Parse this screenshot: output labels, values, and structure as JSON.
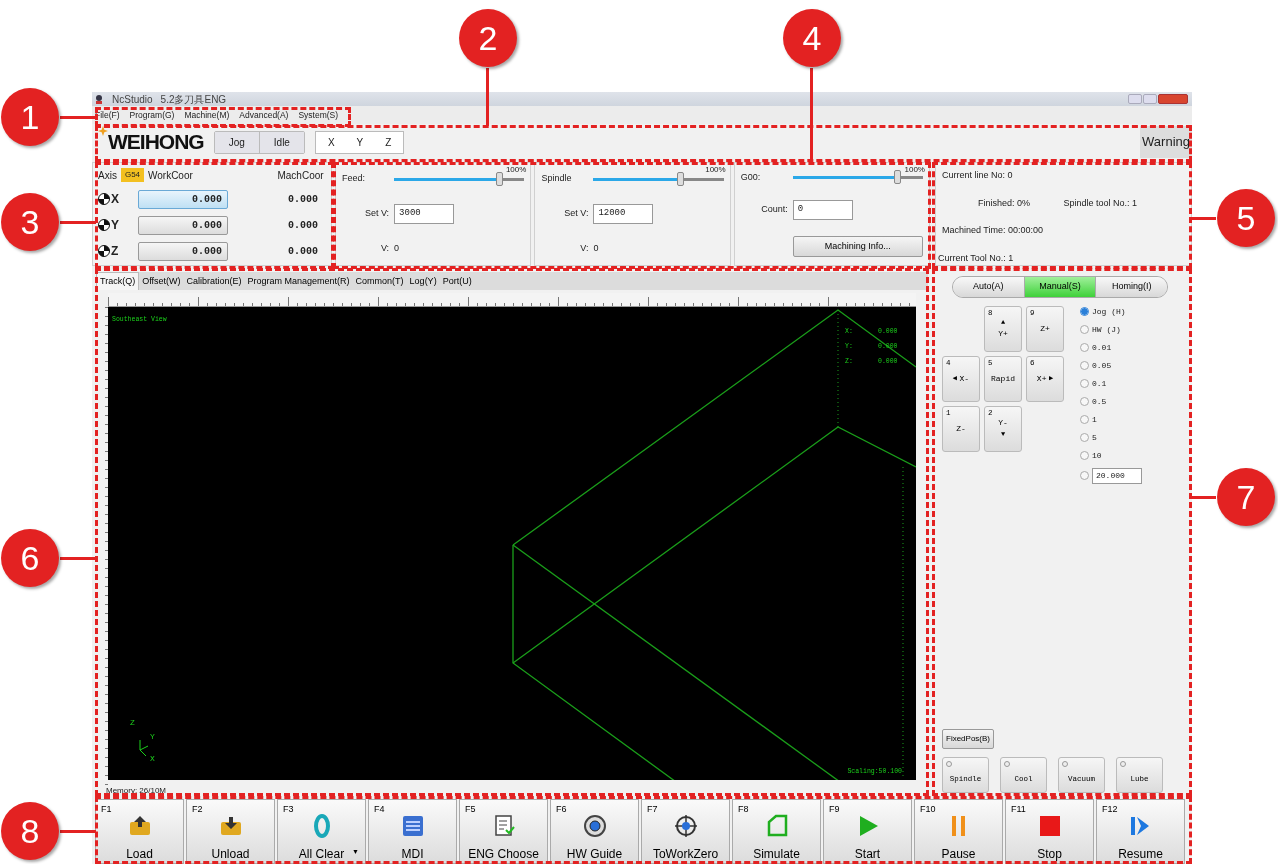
{
  "window": {
    "app": "NcStudio",
    "title": "5.2多刀具ENG"
  },
  "menu": [
    "File(F)",
    "Program(G)",
    "Machine(M)",
    "Advanced(A)",
    "System(S)"
  ],
  "toolbar": {
    "logo": "WEIHONG",
    "mode": "Jog",
    "state": "Idle",
    "axes": [
      "X",
      "Y",
      "Z"
    ],
    "warning": "Warning"
  },
  "coords": {
    "axis_label": "Axis",
    "cs": "G54",
    "work_label": "WorkCoor",
    "mach_label": "MachCoor",
    "rows": [
      {
        "axis": "X",
        "work": "0.000",
        "mach": "0.000",
        "selected": true
      },
      {
        "axis": "Y",
        "work": "0.000",
        "mach": "0.000",
        "selected": false
      },
      {
        "axis": "Z",
        "work": "0.000",
        "mach": "0.000",
        "selected": false
      }
    ]
  },
  "rates": [
    {
      "label": "Feed:",
      "max": "100%",
      "level": 0.81,
      "field_label": "Set V:",
      "field": "3000",
      "reading_label": "V:",
      "reading": "0"
    },
    {
      "label": "Spindle",
      "max": "100%",
      "level": 0.67,
      "field_label": "Set V:",
      "field": "12000",
      "reading_label": "V:",
      "reading": "0"
    },
    {
      "label": "G00:",
      "max": "100%",
      "level": 0.81,
      "field_label": "Count:",
      "field": "0",
      "button": "Machining Info..."
    }
  ],
  "info": [
    "Current line No: 0",
    "Finished: 0%",
    "Spindle tool No.: 1",
    "Machined Time: 00:00:00",
    "Current Tool No.: 1"
  ],
  "view_tabs": [
    {
      "label": "Track(Q)",
      "selected": true
    },
    {
      "label": "Offset(W)",
      "selected": false
    },
    {
      "label": "Calibration(E)",
      "selected": false
    },
    {
      "label": "Program Management(R)",
      "selected": false
    },
    {
      "label": "Common(T)",
      "selected": false
    },
    {
      "label": "Log(Y)",
      "selected": false
    },
    {
      "label": "Port(U)",
      "selected": false
    }
  ],
  "view": {
    "name": "Southeast View",
    "readout": [
      {
        "axis": "X:",
        "value": "0.000"
      },
      {
        "axis": "Y:",
        "value": "0.000"
      },
      {
        "axis": "Z:",
        "value": "0.000"
      }
    ],
    "scaling": "Scaling:50.100",
    "memory": "Memory: 26/10M",
    "triad": [
      "Z",
      "Y",
      "X"
    ]
  },
  "modes": [
    {
      "label": "Auto(A)",
      "selected": false
    },
    {
      "label": "Manual(S)",
      "selected": true
    },
    {
      "label": "Homing(I)",
      "selected": false
    }
  ],
  "jog_keys": [
    {
      "key": "8",
      "label": "Y+",
      "arrow": "▲",
      "kind": "up"
    },
    {
      "key": "9",
      "label": "Z+",
      "kind": "plain"
    },
    {
      "key": "4",
      "label": "X-",
      "arrow": "◀",
      "kind": "left"
    },
    {
      "key": "5",
      "label": "Rapid",
      "kind": "plain"
    },
    {
      "key": "6",
      "label": "X+",
      "arrow": "▶",
      "kind": "right"
    },
    {
      "key": "1",
      "label": "Z-",
      "kind": "plain"
    },
    {
      "key": "2",
      "label": "Y-",
      "arrow": "▼",
      "kind": "down"
    }
  ],
  "steps": [
    {
      "label": "Jog (H)",
      "selected": true
    },
    {
      "label": "HW (J)",
      "selected": false
    },
    {
      "label": "0.01",
      "selected": false
    },
    {
      "label": "0.05",
      "selected": false
    },
    {
      "label": "0.1",
      "selected": false
    },
    {
      "label": "0.5",
      "selected": false
    },
    {
      "label": "1",
      "selected": false
    },
    {
      "label": "5",
      "selected": false
    },
    {
      "label": "10",
      "selected": false
    },
    {
      "label": "20.000",
      "kind": "field",
      "selected": false
    }
  ],
  "fixed_pos": "FixedPos(B)",
  "outputs": [
    {
      "label": "Spindle",
      "on": false
    },
    {
      "label": "Cool",
      "on": false
    },
    {
      "label": "Vacuum",
      "on": false
    },
    {
      "label": "Lube",
      "on": false
    }
  ],
  "functions": [
    {
      "key": "F1",
      "label": "Load",
      "kind": "load"
    },
    {
      "key": "F2",
      "label": "Unload",
      "kind": "unload"
    },
    {
      "key": "F3",
      "label": "All Clear",
      "kind": "clear",
      "dropdown": "▼"
    },
    {
      "key": "F4",
      "label": "MDI",
      "kind": "mdi"
    },
    {
      "key": "F5",
      "label": "ENG Choose",
      "kind": "eng"
    },
    {
      "key": "F6",
      "label": "HW Guide",
      "kind": "hw"
    },
    {
      "key": "F7",
      "label": "ToWorkZero",
      "kind": "zero"
    },
    {
      "key": "F8",
      "label": "Simulate",
      "kind": "simulate"
    },
    {
      "key": "F9",
      "label": "Start",
      "kind": "start"
    },
    {
      "key": "F10",
      "label": "Pause",
      "kind": "pause"
    },
    {
      "key": "F11",
      "label": "Stop",
      "kind": "stop"
    },
    {
      "key": "F12",
      "label": "Resume",
      "kind": "resume"
    }
  ],
  "callouts": [
    {
      "number": "1"
    },
    {
      "number": "2"
    },
    {
      "number": "3"
    },
    {
      "number": "4"
    },
    {
      "number": "5"
    },
    {
      "number": "6"
    },
    {
      "number": "7"
    },
    {
      "number": "8"
    }
  ]
}
